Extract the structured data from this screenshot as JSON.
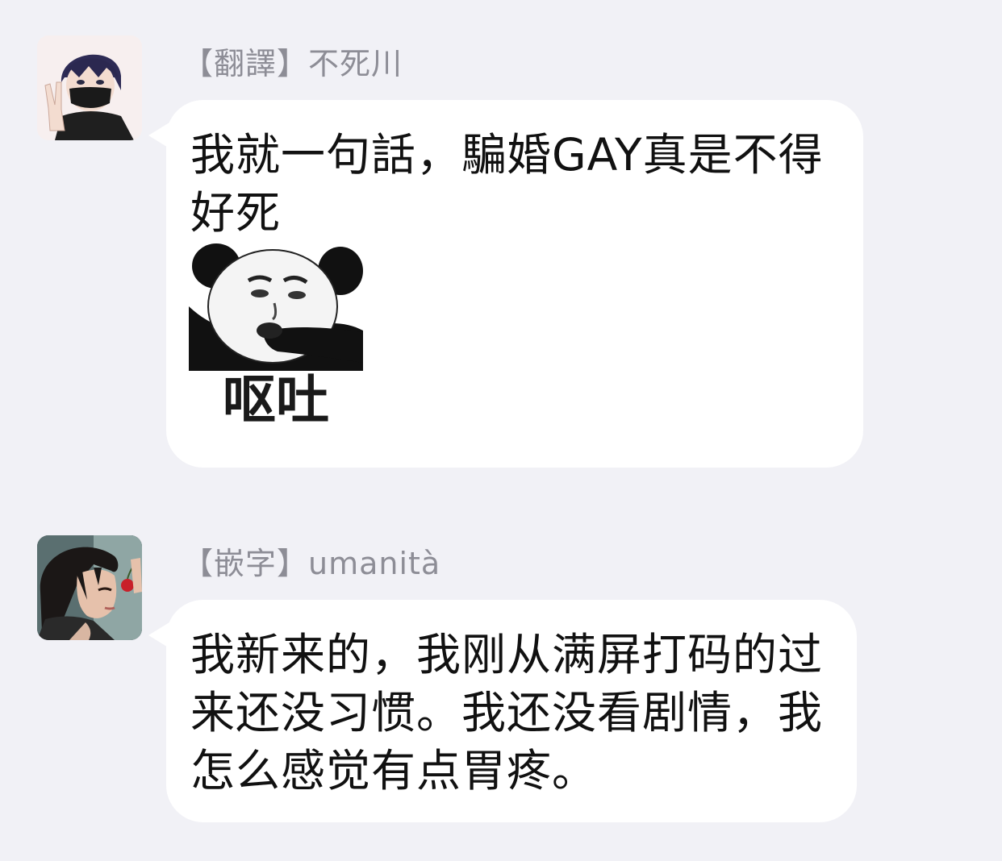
{
  "messages": [
    {
      "sender": "【翻譯】不死川",
      "avatar": "avatar-masked-boy",
      "text": "我就一句話，騙婚GAY真是不得好死",
      "sticker": {
        "icon": "panda-meme-sticker",
        "caption": "呕吐"
      }
    },
    {
      "sender": "【嵌字】umanità",
      "avatar": "avatar-boy-cherry",
      "text": "我新来的，我刚从满屏打码的过来还没习惯。我还没看剧情，我怎么感觉有点胃疼。"
    }
  ],
  "colors": {
    "background": "#f1f1f6",
    "bubble": "#ffffff",
    "sender_text": "#8d8d96",
    "message_text": "#111111"
  }
}
